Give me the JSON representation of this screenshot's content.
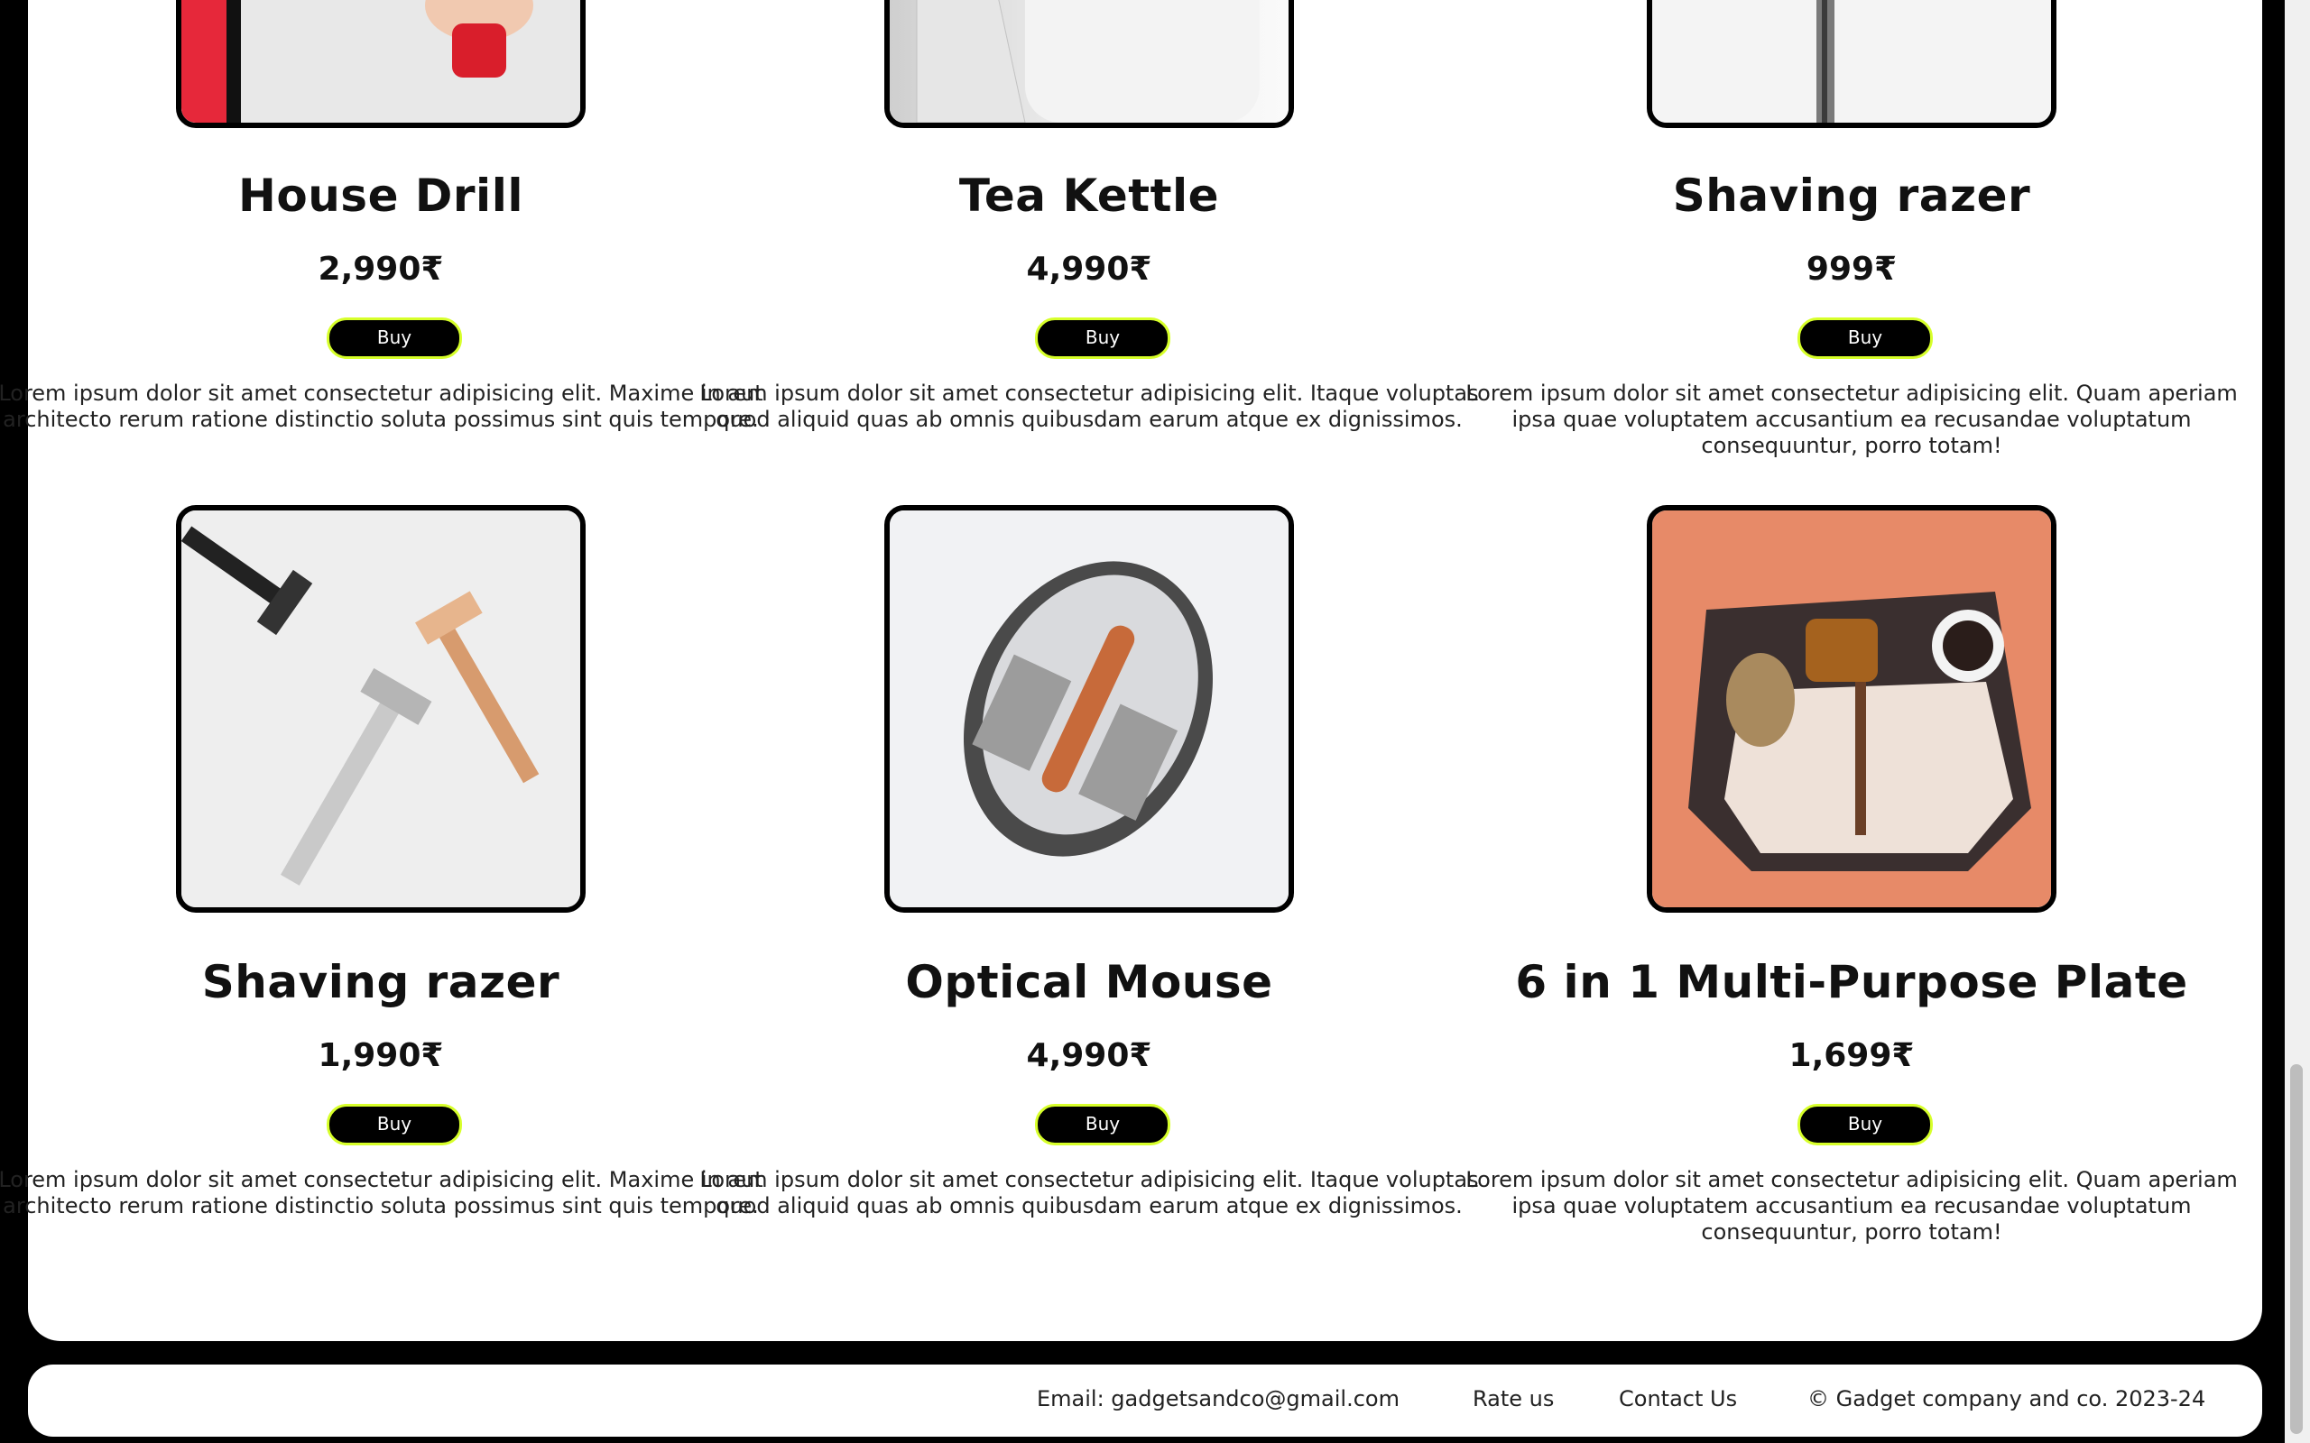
{
  "products": [
    {
      "name": "House Drill",
      "price": "2,990₹",
      "buy": "Buy",
      "desc": "Lorem ipsum dolor sit amet consectetur adipisicing elit. Maxime in aut architecto rerum ratione distinctio soluta possimus sint quis tempore."
    },
    {
      "name": "Tea Kettle",
      "price": "4,990₹",
      "buy": "Buy",
      "desc": "Lorem ipsum dolor sit amet consectetur adipisicing elit. Itaque voluptas quod aliquid quas ab omnis quibusdam earum atque ex dignissimos."
    },
    {
      "name": "Shaving razer",
      "price": "999₹",
      "buy": "Buy",
      "desc": "Lorem ipsum dolor sit amet consectetur adipisicing elit. Quam aperiam ipsa quae voluptatem accusantium ea recusandae voluptatum consequuntur, porro totam!"
    },
    {
      "name": "Shaving razer",
      "price": "1,990₹",
      "buy": "Buy",
      "desc": "Lorem ipsum dolor sit amet consectetur adipisicing elit. Maxime in aut architecto rerum ratione distinctio soluta possimus sint quis tempore."
    },
    {
      "name": "Optical Mouse",
      "price": "4,990₹",
      "buy": "Buy",
      "desc": "Lorem ipsum dolor sit amet consectetur adipisicing elit. Itaque voluptas quod aliquid quas ab omnis quibusdam earum atque ex dignissimos."
    },
    {
      "name": "6 in 1 Multi-Purpose Plate",
      "price": "1,699₹",
      "buy": "Buy",
      "desc": "Lorem ipsum dolor sit amet consectetur adipisicing elit. Quam aperiam ipsa quae voluptatem accusantium ea recusandae voluptatum consequuntur, porro totam!"
    }
  ],
  "footer": {
    "email": "Email: gadgetsandco@gmail.com",
    "rate": "Rate us",
    "contact": "Contact Us",
    "copyright": "© Gadget company and co. 2023-24"
  },
  "colors": {
    "accent": "#d7ff2a",
    "background": "#000000",
    "card": "#ffffff"
  }
}
